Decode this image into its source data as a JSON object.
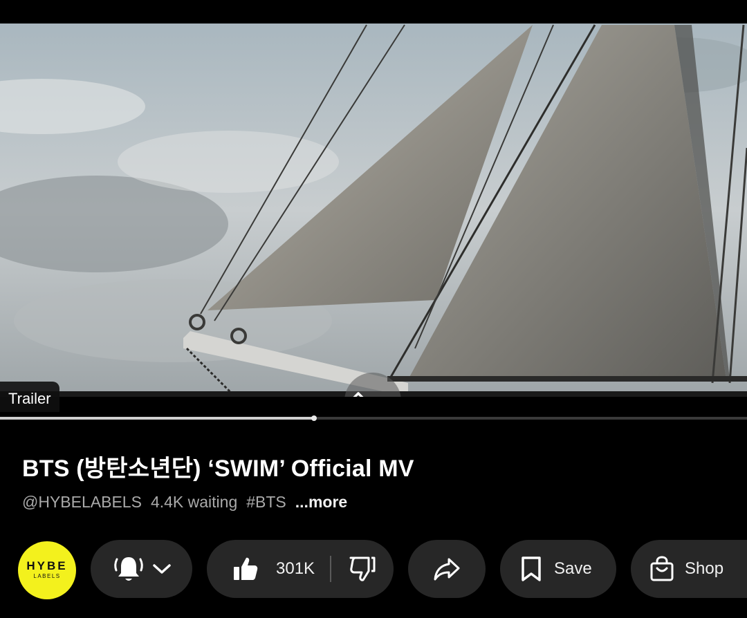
{
  "video": {
    "chip_label": "Trailer",
    "progress_fraction": 0.42
  },
  "title": "BTS (방탄소년단) ‘SWIM’ Official MV",
  "meta": {
    "channel_handle": "@HYBELABELS",
    "waiting": "4.4K waiting",
    "hashtag": "#BTS",
    "more": "...more"
  },
  "channel": {
    "avatar_line1": "HYBE",
    "avatar_line2": "LABELS",
    "avatar_color": "#f3f11d"
  },
  "actions": {
    "notify_icon": "bell-ringing-icon",
    "like_icon": "thumbs-up-icon",
    "like_count": "301K",
    "dislike_icon": "thumbs-down-icon",
    "share_icon": "share-icon",
    "save_label": "Save",
    "save_icon": "bookmark-icon",
    "shop_label": "Shop",
    "shop_icon": "shopping-bag-icon"
  },
  "colors": {
    "background": "#000000",
    "pill": "#272727",
    "text_dim": "#aaaaaa"
  }
}
